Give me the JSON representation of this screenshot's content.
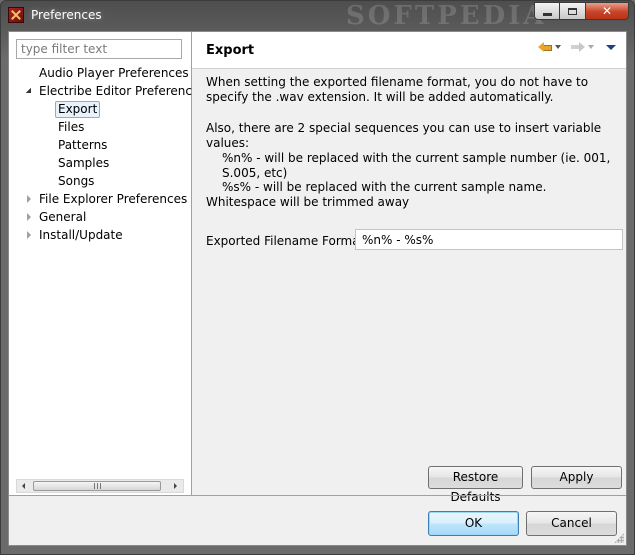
{
  "window": {
    "title": "Preferences",
    "watermark": "SOFTPEDIA"
  },
  "filter": {
    "placeholder": "type filter text",
    "value": ""
  },
  "tree": {
    "items": [
      {
        "label": "Audio Player Preferences"
      },
      {
        "label": "Electribe Editor Preferences"
      },
      {
        "label": "Export"
      },
      {
        "label": "Files"
      },
      {
        "label": "Patterns"
      },
      {
        "label": "Samples"
      },
      {
        "label": "Songs"
      },
      {
        "label": "File Explorer Preferences"
      },
      {
        "label": "General"
      },
      {
        "label": "Install/Update"
      }
    ],
    "selected": "Export"
  },
  "page": {
    "title": "Export",
    "paragraphs": [
      "When setting the exported filename format, you do not have to specify the .wav extension. It will be added automatically.",
      "Also, there are 2 special sequences you can use to insert variable values:",
      "%n% - will be replaced with the current sample number (ie. 001, S.005, etc)",
      "%s% - will be replaced with the current sample name. Whitespace will be trimmed away"
    ],
    "field_label": "Exported Filename Format:",
    "field_value": "%n% - %s%",
    "restore_label": "Restore Defaults",
    "apply_label": "Apply"
  },
  "dialog": {
    "ok_label": "OK",
    "cancel_label": "Cancel"
  },
  "colors": {
    "selection_border": "#84acdd",
    "selection_fill": "#e8f2fc",
    "back_arrow": "#e8a628",
    "close_button": "#c8452a"
  },
  "icons": [
    "app-icon",
    "minimize-icon",
    "maximize-icon",
    "close-icon",
    "back-arrow-icon",
    "forward-arrow-icon",
    "chevron-down-icon",
    "view-menu-icon",
    "expand-arrow-icon",
    "collapse-arrow-icon",
    "resize-grip-icon"
  ]
}
